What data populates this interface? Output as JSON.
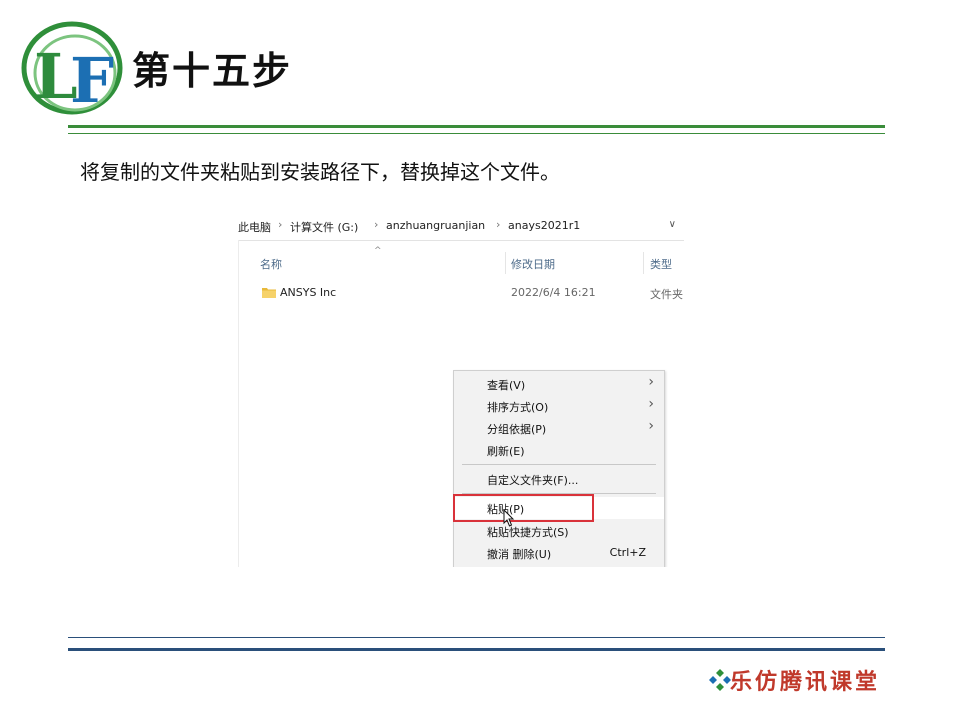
{
  "slide": {
    "logo_text": "LF",
    "title": "第十五步",
    "instruction": "将复制的文件夹粘贴到安装路径下，替换掉这个文件。",
    "footer": "乐仿腾讯课堂",
    "colors": {
      "green_rule": "#3a8c3a",
      "blue_rule": "#2a4f7a",
      "brand_red": "#c0392b",
      "highlight_red": "#d9323a"
    }
  },
  "explorer": {
    "breadcrumbs": [
      "此电脑",
      "计算文件 (G:)",
      "anzhuangruanjian",
      "anays2021r1"
    ],
    "columns": {
      "name": "名称",
      "modified": "修改日期",
      "type": "类型"
    },
    "rows": [
      {
        "icon": "folder-icon",
        "name": "ANSYS Inc",
        "modified": "2022/6/4 16:21",
        "type": "文件夹"
      }
    ]
  },
  "context_menu": {
    "items": [
      {
        "label": "查看(V)",
        "submenu": true
      },
      {
        "label": "排序方式(O)",
        "submenu": true
      },
      {
        "label": "分组依据(P)",
        "submenu": true
      },
      {
        "label": "刷新(E)"
      },
      {
        "label": "自定义文件夹(F)..."
      },
      {
        "label": "粘贴(P)",
        "highlighted": true
      },
      {
        "label": "粘贴快捷方式(S)"
      },
      {
        "label": "撤消 删除(U)",
        "shortcut": "Ctrl+Z"
      }
    ]
  }
}
